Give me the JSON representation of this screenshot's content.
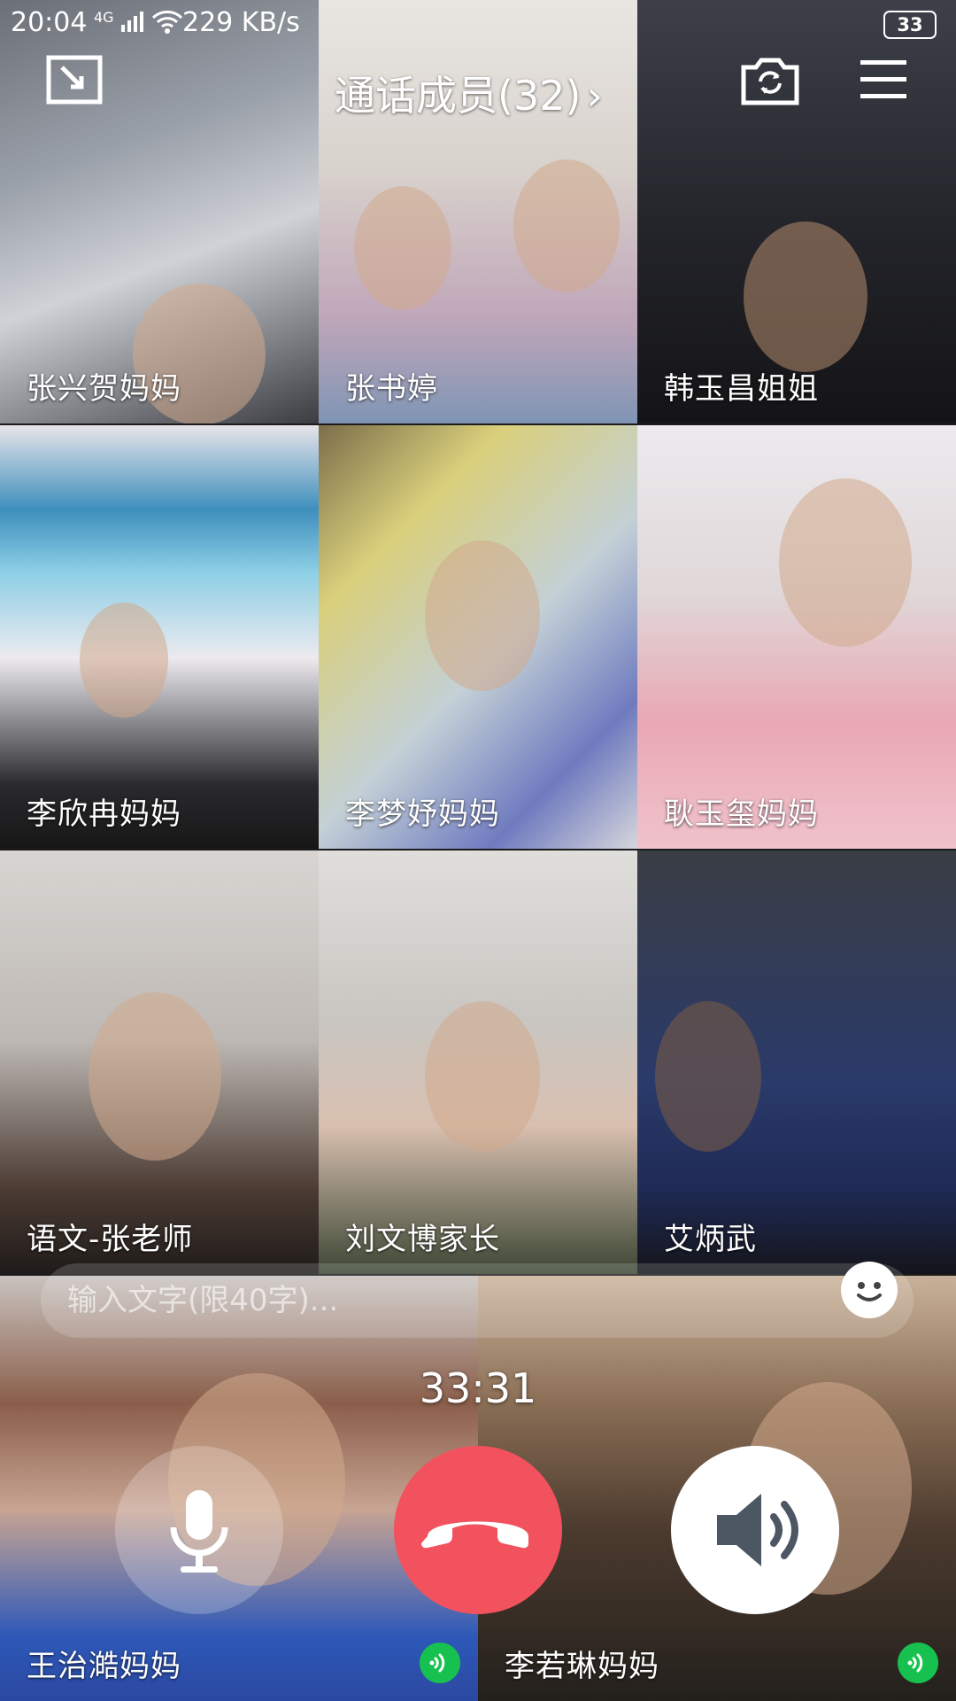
{
  "status_bar": {
    "time": "20:04",
    "network": "4G",
    "speed": "229 KB/s",
    "battery": "33"
  },
  "header": {
    "members_title": "通话成员(32)",
    "chevron": "›"
  },
  "participants": [
    {
      "name": "张兴贺妈妈"
    },
    {
      "name": "张书婷"
    },
    {
      "name": "韩玉昌姐姐"
    },
    {
      "name": "李欣冉妈妈"
    },
    {
      "name": "李梦妤妈妈"
    },
    {
      "name": "耿玉玺妈妈"
    },
    {
      "name": "语文-张老师"
    },
    {
      "name": "刘文博家长"
    },
    {
      "name": "艾炳武"
    },
    {
      "name": "王治澔妈妈"
    },
    {
      "name": "李若琳妈妈"
    }
  ],
  "chat": {
    "placeholder": "输入文字(限40字)..."
  },
  "call": {
    "timer": "33:31"
  },
  "icons": {
    "minimize": "minimize-icon",
    "switch_camera": "camera-switch-icon",
    "menu": "menu-icon",
    "emoji": "emoji-icon",
    "mic": "microphone-icon",
    "hangup": "hangup-icon",
    "speaker": "speaker-icon",
    "speaking": "speaking-indicator-icon"
  },
  "colors": {
    "hangup": "#f2525e",
    "speaking_indicator": "#17c14f"
  }
}
